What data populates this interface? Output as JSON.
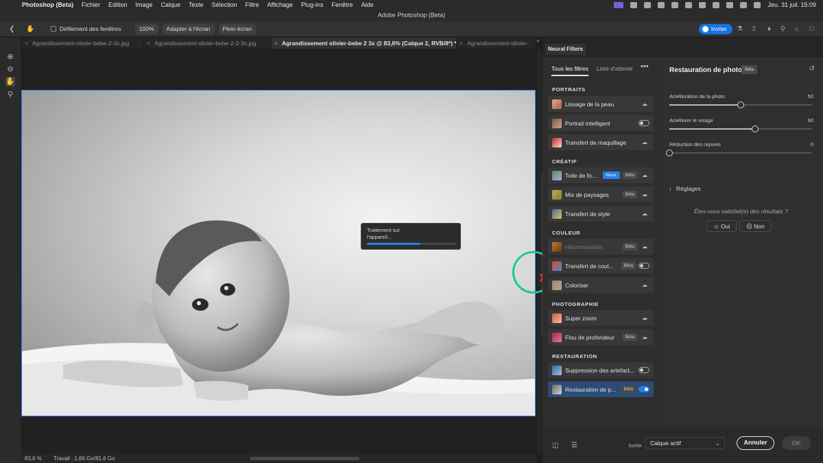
{
  "menubar": {
    "app": "Photoshop (Beta)",
    "items": [
      "Fichier",
      "Edition",
      "Image",
      "Calque",
      "Texte",
      "Sélection",
      "Filtre",
      "Affichage",
      "Plug-ins",
      "Fenêtre",
      "Aide"
    ],
    "clock": "Jeu. 31 juil.  15:09"
  },
  "window": {
    "title": "Adobe Photoshop (Beta)"
  },
  "options": {
    "scroll_all": "Défilement des fenêtres",
    "zoom": "100%",
    "fit_screen": "Adapter à l'écran",
    "fill_screen": "Plein écran",
    "invite": "Inviter"
  },
  "tabs": [
    {
      "label": "Agrandissement-olivier-bebe-2-3x.jpg"
    },
    {
      "label": "Agrandissement-olivier-bebe-2-2-3x.jpg"
    },
    {
      "label": "Agrandissement olivier-bebe 2 3x @ 83,6% (Calque 2, RVB/8*) *"
    },
    {
      "label": "Agrandissement-olivier-"
    }
  ],
  "status": {
    "zoom": "83,6 %",
    "work": "Travail : 1,66 Go/81,6 Go"
  },
  "processing": {
    "text_line1": "Traitement sur",
    "text_line2": "l'appareil...",
    "progress": 0.6
  },
  "panel": {
    "title": "Neural Filters",
    "tab_all": "Tous les filtres",
    "tab_wait": "Liste d'attente",
    "more": "•••",
    "sections": {
      "portraits": "PORTRAITS",
      "creatif": "CRÉATIF",
      "couleur": "COULEUR",
      "photographie": "PHOTOGRAPHIE",
      "restauration": "RESTAURATION"
    },
    "filters": [
      {
        "label": "Lissage de la peau",
        "badge": "",
        "right": "cloud"
      },
      {
        "label": "Portrait intelligent",
        "badge": "",
        "right": "toggle-off"
      },
      {
        "label": "Transfert de maquillage",
        "badge": "",
        "right": "cloud"
      },
      {
        "label": "Toile de fo...",
        "badge": "Nouv.",
        "badge2": "Bêta",
        "right": "cloud"
      },
      {
        "label": "Mix de paysages",
        "badge": "Bêta",
        "right": "cloud"
      },
      {
        "label": "Transfert de style",
        "badge": "",
        "right": "cloud"
      },
      {
        "label": "Harmonisation",
        "badge": "Bêta",
        "right": "cloud"
      },
      {
        "label": "Transfert de coul...",
        "badge": "Bêta",
        "right": "toggle-off"
      },
      {
        "label": "Coloriser",
        "badge": "",
        "right": "cloud"
      },
      {
        "label": "Super zoom",
        "badge": "",
        "right": "cloud"
      },
      {
        "label": "Flou de profondeur",
        "badge": "Bêta",
        "right": "cloud"
      },
      {
        "label": "Suppression des artefact...",
        "badge": "",
        "right": "toggle-off"
      },
      {
        "label": "Restauration de p...",
        "badge": "Bêta",
        "right": "toggle-on"
      }
    ],
    "detail": {
      "title": "Restauration de photos",
      "badge": "Bêta",
      "sliders": [
        {
          "label": "Amélioration de la photo",
          "value": 50,
          "max": 100
        },
        {
          "label": "Améliorer le visage",
          "value": 60,
          "max": 100
        },
        {
          "label": "Réduction des rayures",
          "value": 0,
          "max": 100
        }
      ],
      "reglages": "Réglages",
      "satisfaction": "Êtes-vous satisfait(e) des résultats ?",
      "yes": "Oui",
      "no": "Non"
    },
    "footer": {
      "output_label": "Sortie",
      "output_value": "Calque actif",
      "cancel": "Annuler",
      "ok": "OK"
    }
  },
  "colors": {
    "accent": "#2680eb",
    "cursor_ring": "#1ec78b"
  }
}
